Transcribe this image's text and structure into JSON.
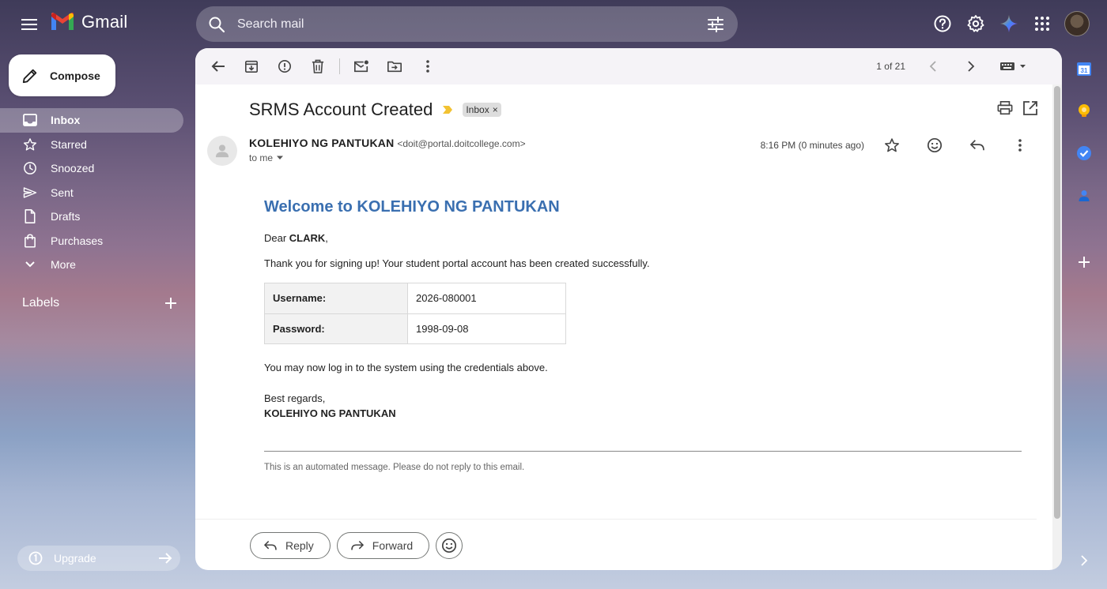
{
  "app": {
    "name": "Gmail"
  },
  "search": {
    "placeholder": "Search mail"
  },
  "sidebar": {
    "compose_label": "Compose",
    "items": [
      {
        "label": "Inbox",
        "icon": "inbox-icon",
        "active": true
      },
      {
        "label": "Starred",
        "icon": "star-icon"
      },
      {
        "label": "Snoozed",
        "icon": "clock-icon"
      },
      {
        "label": "Sent",
        "icon": "send-icon"
      },
      {
        "label": "Drafts",
        "icon": "draft-icon"
      },
      {
        "label": "Purchases",
        "icon": "shopping-bag-icon"
      },
      {
        "label": "More",
        "icon": "chevron-down-icon"
      }
    ],
    "labels_title": "Labels",
    "upgrade_label": "Upgrade"
  },
  "toolbar": {
    "pager": "1 of 21"
  },
  "email": {
    "subject": "SRMS Account Created",
    "label_chip": "Inbox",
    "sender_name": "KOLEHIYO NG PANTUKAN",
    "sender_email": "<doit@portal.doitcollege.com>",
    "to": "to me",
    "time": "8:16 PM (0 minutes ago)",
    "body": {
      "heading": "Welcome to KOLEHIYO NG PANTUKAN",
      "greeting_prefix": "Dear ",
      "greeting_name": "CLARK",
      "greeting_suffix": ",",
      "intro": "Thank you for signing up! Your student portal account has been created successfully.",
      "credentials": [
        {
          "key": "Username:",
          "value": "2026-080001"
        },
        {
          "key": "Password:",
          "value": "1998-09-08"
        }
      ],
      "login_note": "You may now log in to the system using the credentials above.",
      "regards": "Best regards,",
      "signature": "KOLEHIYO NG PANTUKAN",
      "automated_note": "This is an automated message. Please do not reply to this email."
    },
    "reply_label": "Reply",
    "forward_label": "Forward"
  },
  "colors": {
    "heading_blue": "#3a6fb0",
    "important_marker": "#f2c232"
  }
}
